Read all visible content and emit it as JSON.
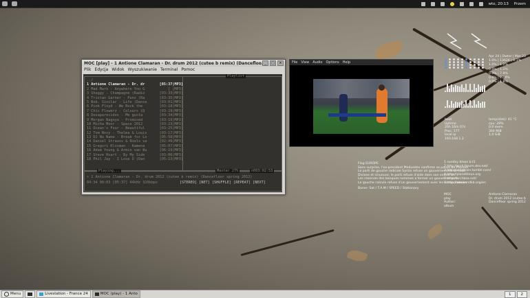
{
  "topbar": {
    "task_label": "",
    "clock": "wto, 20:13",
    "user": "Przem"
  },
  "bottombar": {
    "menu_label": "Menu",
    "tasks": [
      {
        "label": "Livestation - France 24",
        "active": false
      },
      {
        "label": "MOC (play) - 1 Anto",
        "active": true
      }
    ],
    "pager": [
      "1",
      "2"
    ]
  },
  "moc": {
    "title": "MOC [play] - 1 Antione Clamaran - Dr. drum 2012 (cutee b remix) (Dancefloo...",
    "menu": [
      "Plik",
      "Edycja",
      "Widok",
      "Wyszukiwanie",
      "Terminal",
      "Pomoc"
    ],
    "pane_left_title": "",
    "pane_right_title": "Playlist",
    "parent_dir": "../",
    "playlist": [
      {
        "name": "1 Antione Clamaran - Dr. dr",
        "time": "[05:37|MP3]",
        "current": true
      },
      {
        "name": "2 Mad Mark - Anywhere You G",
        "time": "[    |MP3]",
        "current": false
      },
      {
        "name": "3 Shaggy - Champagne (Radio",
        "time": "[03:33|MP3]",
        "current": false
      },
      {
        "name": "4 Tristan Garner - Punx (Ra",
        "time": "[03:35|MP3]",
        "current": false
      },
      {
        "name": "5 Bob. Sinclar - Life (Dance",
        "time": "[03:01|MP3]",
        "current": false
      },
      {
        "name": "6 Pink Floyd - We Rock the",
        "time": "[03:18|MP3]",
        "current": false
      },
      {
        "name": "7 Chic Flowerz - Colours (D",
        "time": "[03:19|MP3]",
        "current": false
      },
      {
        "name": "8 Desaparecidos - Me gusta",
        "time": "[03:34|MP3]",
        "current": false
      },
      {
        "name": "9 Morgan Nagoya - Promised",
        "time": "[03:19|MP3]",
        "current": false
      },
      {
        "name": "10 Micha Moor - Space 2012",
        "time": "[03:23|MP3]",
        "current": false
      },
      {
        "name": "11 Ocean's Four - Beautiful",
        "time": "[03:25|MP3]",
        "current": false
      },
      {
        "name": "12 Tom Novy - Thelma & Louis",
        "time": "[03:17|MP3]",
        "current": false
      },
      {
        "name": "13 DJ No Name - Break for Lo",
        "time": "[05:58|MP3]",
        "current": false
      },
      {
        "name": "14 Daniel Strauss & Niels va",
        "time": "[02:49|MP3]",
        "current": false
      },
      {
        "name": "15 Gregori Klosman - Kamena",
        "time": "[05:07|MP3]",
        "current": false
      },
      {
        "name": "16 Adam Young & Armin van Bu",
        "time": "[06:19|MP3]",
        "current": false
      },
      {
        "name": "17 Steve Hoart - By My Side",
        "time": "[03:06|MP3]",
        "current": false
      },
      {
        "name": "18 Phil Jay - I Love U (Dan",
        "time": "[05:13|MP3]",
        "current": false
      }
    ],
    "status": {
      "playing": "Playing...",
      "master": "Master  27%",
      "count": "n003:02:53",
      "now_playing": "> 1 Antione Clamaran - Dr. drum 2012 (cutee b remix) (Dancefloor spring 2012)",
      "time_line": "04:34 00:03 [05:37]    44kHz  320kbps",
      "flags": "[STEREO] [NET] [SHUFFLE] [REPEAT] [NEXT]"
    }
  },
  "video": {
    "menu": [
      "File",
      "View",
      "Audio",
      "Options",
      "Help"
    ]
  },
  "widgets": {
    "sysinfo": [
      "Apr 24 | Dwtor | Mar 23",
      "1.0% | 1362K | 0.1%",
      "1.0% | 1.2%",
      "0.0% | 1.2%",
      "0.0% | 7.9%",
      "0.0% | 20.0%",
      "0.0% | 1.8%"
    ],
    "news_title": "Flag EUROPE",
    "news_lines": [
      "Sans surprise, l'ex-president Medvedev confirme sa pause de Premier",
      "Le parti de gauche radicale Syriza refuse un gouvernement de coali",
      "Divisee et sinueuse, le parti refuse d'aide dans son entree en",
      "Les reserves des banques nommes a former un gouvernement",
      "La gauche calcule refuse d'un gouvernement avec les conservateurs"
    ],
    "weather": "Baner: Sat / T.A.M / SPEED / Stationary",
    "sys_stats": [
      "boot",
      "Uptime",
      "20h 16m 07s",
      "Proc: 177",
      "local ip",
      "193.168.1.2",
      "temp(disk): 41 °C",
      "cpu: 29%",
      "0.0 mem",
      "304 MiB",
      "1.0 GiB"
    ],
    "links": [
      "1 sunday bloon b.t1",
      "2 http://arch.forum.dev.net/",
      "3 http://wikibrain.tumblr.com/",
      "4 http://planetlinux.org",
      "5 http://archbox.net/",
      "6 http://weekendkb.org/en"
    ],
    "moc_info": [
      "MOC",
      "play",
      "Author:",
      "album",
      "Antione Clamaran",
      "Dr. drum 2012 (cutee b",
      "Dancefloor spring 2012"
    ]
  }
}
